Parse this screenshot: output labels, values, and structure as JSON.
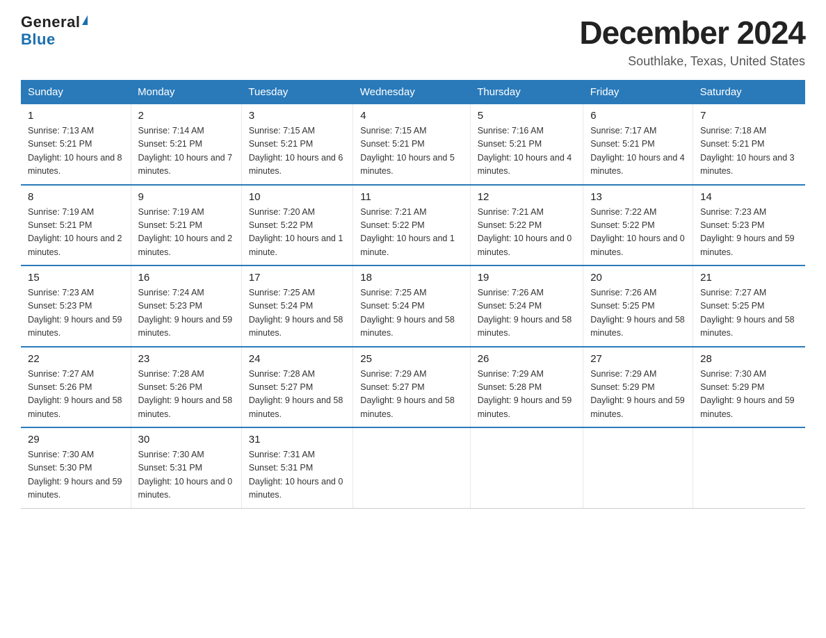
{
  "logo": {
    "general": "General",
    "blue": "Blue"
  },
  "title": "December 2024",
  "subtitle": "Southlake, Texas, United States",
  "days_of_week": [
    "Sunday",
    "Monday",
    "Tuesday",
    "Wednesday",
    "Thursday",
    "Friday",
    "Saturday"
  ],
  "weeks": [
    [
      {
        "day": "1",
        "sunrise": "7:13 AM",
        "sunset": "5:21 PM",
        "daylight": "10 hours and 8 minutes."
      },
      {
        "day": "2",
        "sunrise": "7:14 AM",
        "sunset": "5:21 PM",
        "daylight": "10 hours and 7 minutes."
      },
      {
        "day": "3",
        "sunrise": "7:15 AM",
        "sunset": "5:21 PM",
        "daylight": "10 hours and 6 minutes."
      },
      {
        "day": "4",
        "sunrise": "7:15 AM",
        "sunset": "5:21 PM",
        "daylight": "10 hours and 5 minutes."
      },
      {
        "day": "5",
        "sunrise": "7:16 AM",
        "sunset": "5:21 PM",
        "daylight": "10 hours and 4 minutes."
      },
      {
        "day": "6",
        "sunrise": "7:17 AM",
        "sunset": "5:21 PM",
        "daylight": "10 hours and 4 minutes."
      },
      {
        "day": "7",
        "sunrise": "7:18 AM",
        "sunset": "5:21 PM",
        "daylight": "10 hours and 3 minutes."
      }
    ],
    [
      {
        "day": "8",
        "sunrise": "7:19 AM",
        "sunset": "5:21 PM",
        "daylight": "10 hours and 2 minutes."
      },
      {
        "day": "9",
        "sunrise": "7:19 AM",
        "sunset": "5:21 PM",
        "daylight": "10 hours and 2 minutes."
      },
      {
        "day": "10",
        "sunrise": "7:20 AM",
        "sunset": "5:22 PM",
        "daylight": "10 hours and 1 minute."
      },
      {
        "day": "11",
        "sunrise": "7:21 AM",
        "sunset": "5:22 PM",
        "daylight": "10 hours and 1 minute."
      },
      {
        "day": "12",
        "sunrise": "7:21 AM",
        "sunset": "5:22 PM",
        "daylight": "10 hours and 0 minutes."
      },
      {
        "day": "13",
        "sunrise": "7:22 AM",
        "sunset": "5:22 PM",
        "daylight": "10 hours and 0 minutes."
      },
      {
        "day": "14",
        "sunrise": "7:23 AM",
        "sunset": "5:23 PM",
        "daylight": "9 hours and 59 minutes."
      }
    ],
    [
      {
        "day": "15",
        "sunrise": "7:23 AM",
        "sunset": "5:23 PM",
        "daylight": "9 hours and 59 minutes."
      },
      {
        "day": "16",
        "sunrise": "7:24 AM",
        "sunset": "5:23 PM",
        "daylight": "9 hours and 59 minutes."
      },
      {
        "day": "17",
        "sunrise": "7:25 AM",
        "sunset": "5:24 PM",
        "daylight": "9 hours and 58 minutes."
      },
      {
        "day": "18",
        "sunrise": "7:25 AM",
        "sunset": "5:24 PM",
        "daylight": "9 hours and 58 minutes."
      },
      {
        "day": "19",
        "sunrise": "7:26 AM",
        "sunset": "5:24 PM",
        "daylight": "9 hours and 58 minutes."
      },
      {
        "day": "20",
        "sunrise": "7:26 AM",
        "sunset": "5:25 PM",
        "daylight": "9 hours and 58 minutes."
      },
      {
        "day": "21",
        "sunrise": "7:27 AM",
        "sunset": "5:25 PM",
        "daylight": "9 hours and 58 minutes."
      }
    ],
    [
      {
        "day": "22",
        "sunrise": "7:27 AM",
        "sunset": "5:26 PM",
        "daylight": "9 hours and 58 minutes."
      },
      {
        "day": "23",
        "sunrise": "7:28 AM",
        "sunset": "5:26 PM",
        "daylight": "9 hours and 58 minutes."
      },
      {
        "day": "24",
        "sunrise": "7:28 AM",
        "sunset": "5:27 PM",
        "daylight": "9 hours and 58 minutes."
      },
      {
        "day": "25",
        "sunrise": "7:29 AM",
        "sunset": "5:27 PM",
        "daylight": "9 hours and 58 minutes."
      },
      {
        "day": "26",
        "sunrise": "7:29 AM",
        "sunset": "5:28 PM",
        "daylight": "9 hours and 59 minutes."
      },
      {
        "day": "27",
        "sunrise": "7:29 AM",
        "sunset": "5:29 PM",
        "daylight": "9 hours and 59 minutes."
      },
      {
        "day": "28",
        "sunrise": "7:30 AM",
        "sunset": "5:29 PM",
        "daylight": "9 hours and 59 minutes."
      }
    ],
    [
      {
        "day": "29",
        "sunrise": "7:30 AM",
        "sunset": "5:30 PM",
        "daylight": "9 hours and 59 minutes."
      },
      {
        "day": "30",
        "sunrise": "7:30 AM",
        "sunset": "5:31 PM",
        "daylight": "10 hours and 0 minutes."
      },
      {
        "day": "31",
        "sunrise": "7:31 AM",
        "sunset": "5:31 PM",
        "daylight": "10 hours and 0 minutes."
      },
      null,
      null,
      null,
      null
    ]
  ],
  "labels": {
    "sunrise": "Sunrise:",
    "sunset": "Sunset:",
    "daylight": "Daylight:"
  }
}
